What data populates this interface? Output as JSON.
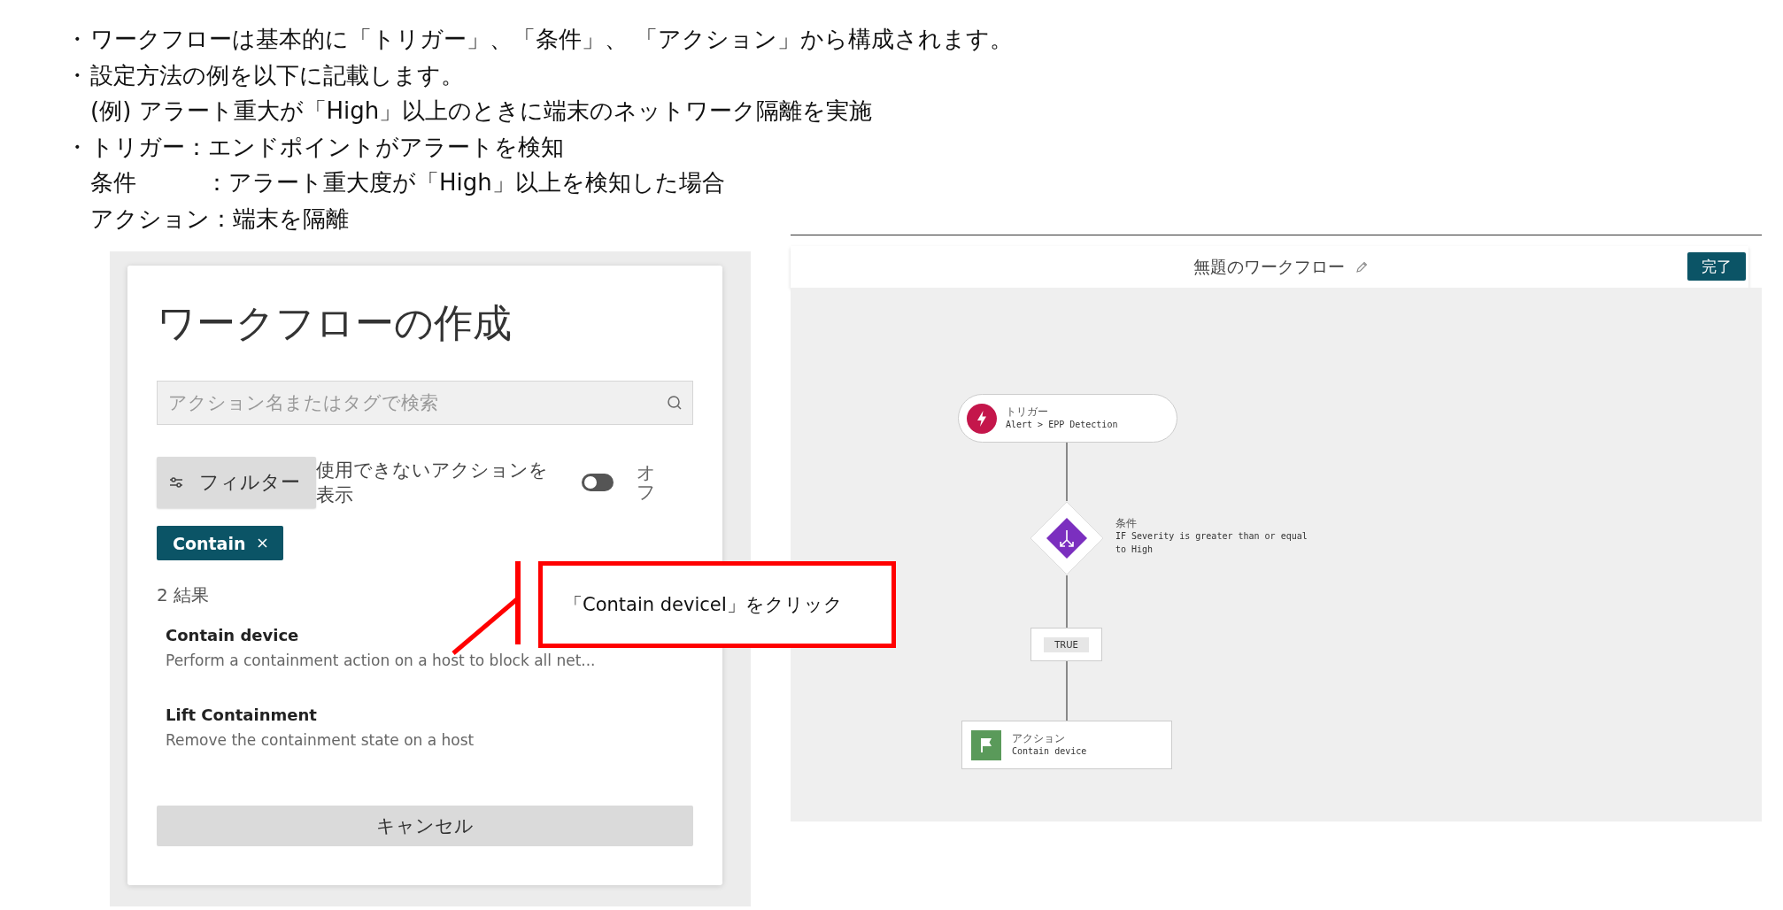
{
  "notes": [
    {
      "bullet": "・",
      "lines": [
        "ワークフローは基本的に「トリガー」、「条件」、 「アクション」から構成されます。"
      ]
    },
    {
      "bullet": "・",
      "lines": [
        "設定方法の例を以下に記載します。",
        "(例) アラート重大が「High」以上のときに端末のネットワーク隔離を実施"
      ]
    },
    {
      "bullet": "・",
      "lines": [
        "トリガー：エンドポイントがアラートを検知",
        "条件　　　：アラート重大度が「High」以上を検知した場合",
        "アクション：端末を隔離"
      ]
    }
  ],
  "create_panel": {
    "title": "ワークフローの作成",
    "search": {
      "placeholder": "アクション名またはタグで検索"
    },
    "filter_button": "フィルター",
    "show_unavailable": {
      "label": "使用できないアクションを表示",
      "on": false,
      "state_label": "オフ"
    },
    "chips": [
      {
        "label": "Contain"
      }
    ],
    "result_count": "2 結果",
    "results": [
      {
        "name": "Contain device",
        "description": "Perform a containment action on a host to block all net..."
      },
      {
        "name": "Lift Containment",
        "description": "Remove the containment state on a host"
      }
    ],
    "cancel_button": "キャンセル"
  },
  "callout": {
    "text": "「Contain deviceI」をクリック"
  },
  "workflow_editor": {
    "title": "無題のワークフロー",
    "done_button": "完了",
    "trigger": {
      "label": "トリガー",
      "text": "Alert > EPP Detection"
    },
    "condition": {
      "label": "条件",
      "text": "IF Severity is greater than or equal to High"
    },
    "branch": "TRUE",
    "action": {
      "label": "アクション",
      "text": "Contain device"
    }
  }
}
